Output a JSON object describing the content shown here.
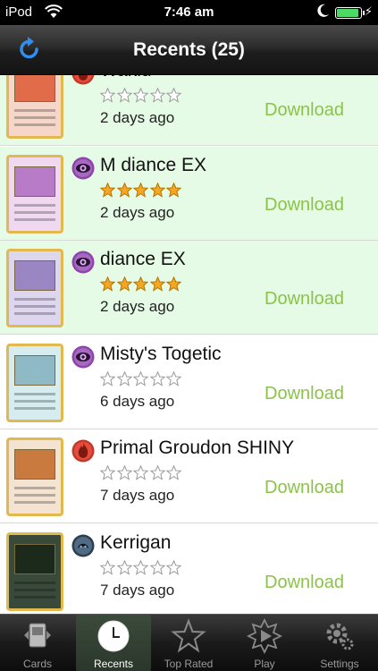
{
  "status_bar": {
    "carrier": "iPod",
    "time": "7:46 am"
  },
  "nav": {
    "title": "Recents (25)"
  },
  "colors": {
    "download_green": "#8bc34a",
    "highlight_row": "#e5fbe5",
    "star_gold": "#f5a623",
    "star_empty": "#bdbdbd"
  },
  "cards": [
    {
      "name": "Waklu",
      "type": "fire-type-icon",
      "rating": 0,
      "ago": "2 days ago",
      "action": "Download",
      "highlight": true
    },
    {
      "name": "M diance EX",
      "type": "psychic-type-icon",
      "rating": 5,
      "ago": "2 days ago",
      "action": "Download",
      "highlight": true
    },
    {
      "name": "diance EX",
      "type": "psychic-type-icon",
      "rating": 5,
      "ago": "2 days ago",
      "action": "Download",
      "highlight": true
    },
    {
      "name": "Misty's Togetic",
      "type": "psychic-type-icon",
      "rating": 0,
      "ago": "6 days ago",
      "action": "Download",
      "highlight": false
    },
    {
      "name": "Primal Groudon SHINY",
      "type": "fire-type-icon",
      "rating": 0,
      "ago": "7 days ago",
      "action": "Download",
      "highlight": false
    },
    {
      "name": "Kerrigan",
      "type": "dark-type-icon",
      "rating": 0,
      "ago": "7 days ago",
      "action": "Download",
      "highlight": false
    }
  ],
  "tabs": [
    {
      "label": "Cards",
      "icon": "cards-icon",
      "active": false
    },
    {
      "label": "Recents",
      "icon": "clock-icon",
      "active": true
    },
    {
      "label": "Top Rated",
      "icon": "star-icon",
      "active": false
    },
    {
      "label": "Play",
      "icon": "play-icon",
      "active": false
    },
    {
      "label": "Settings",
      "icon": "gear-icon",
      "active": false
    }
  ]
}
